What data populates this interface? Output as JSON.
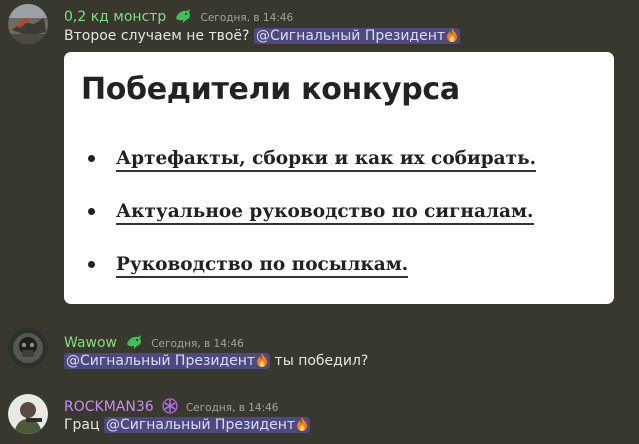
{
  "messages": [
    {
      "username": "0,2 кд монстр",
      "timestamp": "Сегодня, в 14:46",
      "text_before": "Второе случаем не твоё?",
      "mention": "@Сигнальный Президент",
      "text_after": "",
      "embed": {
        "title": "Победители конкурса",
        "items": [
          "Артефакты, сборки и как их собирать.",
          "Актуальное руководство по сигналам.",
          "Руководство по посылкам."
        ]
      }
    },
    {
      "username": "Wawow",
      "timestamp": "Сегодня, в 14:46",
      "mention": "@Сигнальный Президент",
      "text_after": "ты победил?"
    },
    {
      "username": "ROCKMAN36",
      "timestamp": "Сегодня, в 14:46",
      "text_before": "Грац",
      "mention": "@Сигнальный Президент"
    }
  ],
  "colors": {
    "background": "#38382f",
    "green_name": "#7ee07b",
    "purple_name": "#c98df5",
    "mention_bg": "#4e4a80"
  }
}
